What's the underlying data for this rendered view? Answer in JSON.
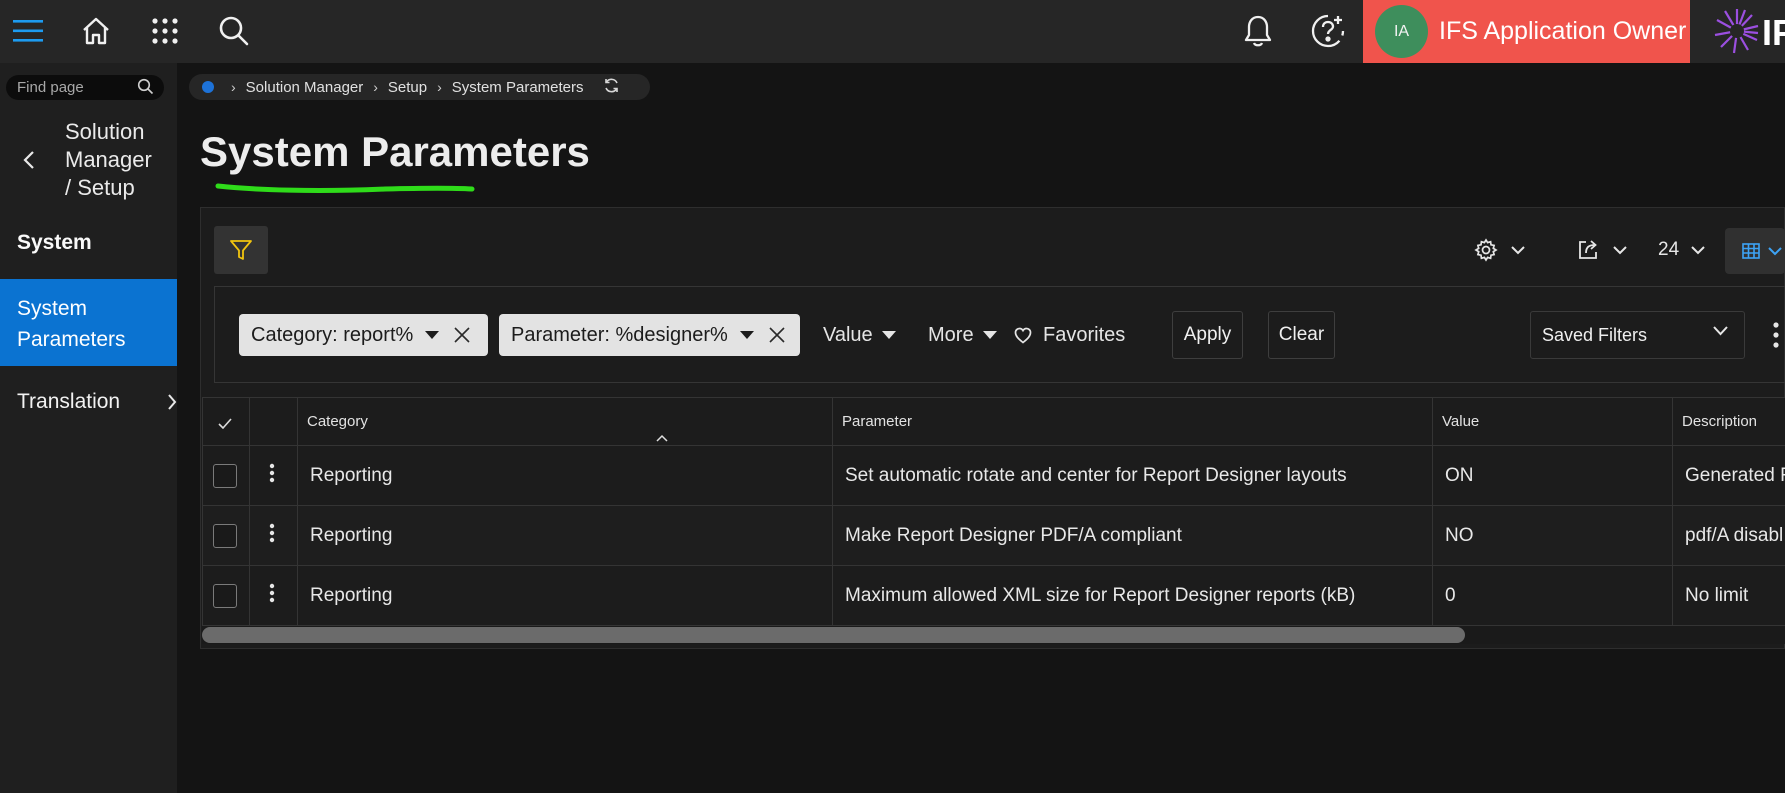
{
  "topbar": {
    "icons": [
      "hamburger-icon",
      "home-icon",
      "app-grid-icon",
      "search-icon",
      "bell-icon",
      "help-icon"
    ],
    "user": {
      "initials": "IA",
      "name": "IFS Application Owner"
    },
    "logo_text": "IF",
    "colors": {
      "bar": "#262626",
      "user_chip": "#f0544c",
      "avatar": "#3e8e5c",
      "accent": "#1d9bf0"
    }
  },
  "sidebar": {
    "search_placeholder": "Find page",
    "title_lines": [
      "Solution",
      "Manager",
      "/ Setup"
    ],
    "section": "System",
    "items": [
      {
        "label_lines": [
          "System",
          "Parameters"
        ],
        "active": true
      },
      {
        "label": "Translation",
        "has_children": true
      }
    ],
    "active_color": "#0b73d1"
  },
  "breadcrumb": {
    "items": [
      "Solution Manager",
      "Setup",
      "System Parameters"
    ]
  },
  "page": {
    "title": "System Parameters",
    "underline_color": "#2fdc1a"
  },
  "toolbar": {
    "page_size": "24",
    "icons": [
      "settings-icon",
      "export-icon",
      "table-view-icon"
    ]
  },
  "filters": {
    "chips": [
      {
        "label": "Category: report%"
      },
      {
        "label": "Parameter: %designer%"
      }
    ],
    "dropdowns": {
      "value": "Value",
      "more": "More"
    },
    "favorites": "Favorites",
    "apply": "Apply",
    "clear": "Clear",
    "saved_filters": "Saved Filters"
  },
  "table": {
    "columns": [
      "Category",
      "Parameter",
      "Value",
      "Description"
    ],
    "sorted_column": "Category",
    "rows": [
      {
        "category": "Reporting",
        "parameter": "Set automatic rotate and center for Report Designer layouts",
        "value": "ON",
        "description": "Generated R"
      },
      {
        "category": "Reporting",
        "parameter": "Make Report Designer PDF/A compliant",
        "value": "NO",
        "description": "pdf/A disabl"
      },
      {
        "category": "Reporting",
        "parameter": "Maximum allowed XML size for Report Designer reports (kB)",
        "value": "0",
        "description": "No limit"
      }
    ]
  }
}
